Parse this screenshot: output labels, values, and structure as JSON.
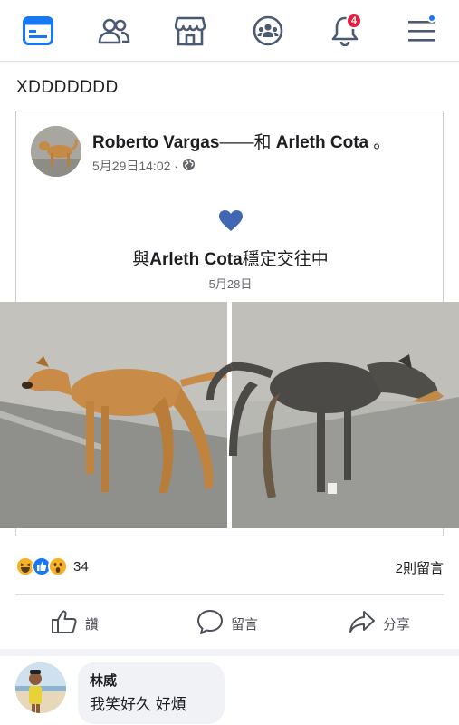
{
  "nav": {
    "items": [
      {
        "name": "news-feed-icon",
        "active": true
      },
      {
        "name": "friends-icon"
      },
      {
        "name": "marketplace-icon"
      },
      {
        "name": "groups-icon"
      },
      {
        "name": "notifications-icon",
        "badge": "4"
      },
      {
        "name": "menu-icon"
      }
    ],
    "accent": "#1877f2",
    "icon_color": "#4b5a73"
  },
  "post": {
    "text": "XDDDDDDD",
    "shared": {
      "author": "Roberto Vargas",
      "connector": "——和 ",
      "partner": "Arleth Cota",
      "suffix": " 。",
      "timestamp": "5月29日14:02 · ",
      "privacy_icon": "globe-icon",
      "life_event_icon": "heart-icon",
      "event_prefix": "與",
      "event_name": "Arleth Cota",
      "event_suffix": "穩定交往中",
      "event_date": "5月28日"
    },
    "reactions": {
      "icons": [
        "haha-icon",
        "like-icon",
        "wow-icon"
      ],
      "count": "34"
    },
    "comments_count": "2則留言",
    "actions": {
      "like": "讚",
      "comment": "留言",
      "share": "分享"
    }
  },
  "comment": {
    "author": "林威",
    "text": "我笑好久 好煩"
  }
}
